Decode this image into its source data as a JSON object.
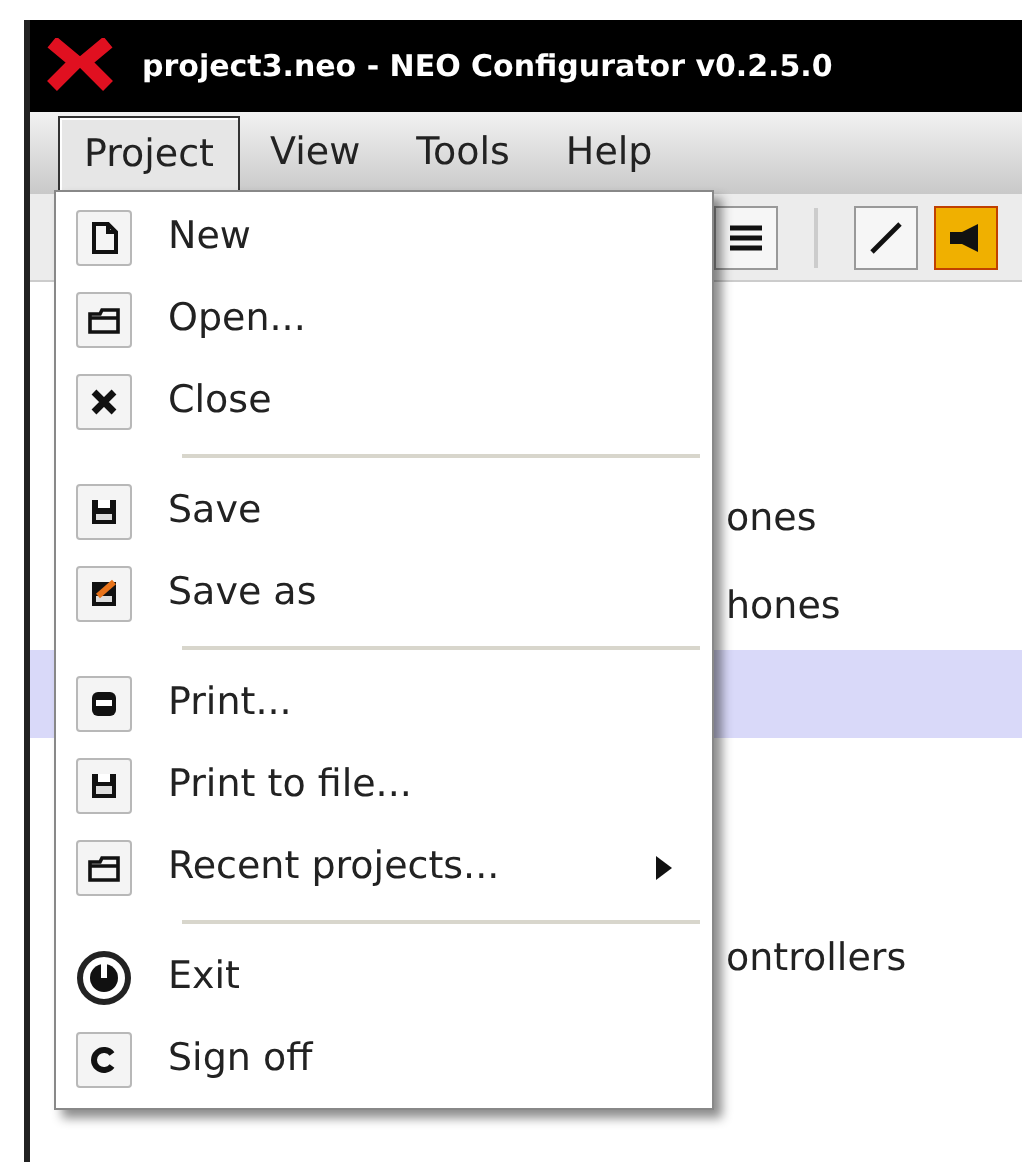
{
  "window": {
    "title": "project3.neo - NEO Configurator v0.2.5.0"
  },
  "menubar": [
    {
      "label": "Project",
      "selected": true
    },
    {
      "label": "View",
      "selected": false
    },
    {
      "label": "Tools",
      "selected": false
    },
    {
      "label": "Help",
      "selected": false
    }
  ],
  "content_rows": [
    {
      "text": "ones",
      "selected": false
    },
    {
      "text": "hones",
      "selected": false
    },
    {
      "selected": true
    },
    {
      "selected": false
    },
    {
      "selected": false
    },
    {
      "text": "ontrollers",
      "selected": false
    }
  ],
  "project_menu": {
    "groups": [
      [
        {
          "label": "New"
        },
        {
          "label": "Open..."
        },
        {
          "label": "Close"
        }
      ],
      [
        {
          "label": "Save"
        },
        {
          "label": "Save as"
        }
      ],
      [
        {
          "label": "Print..."
        },
        {
          "label": "Print to file..."
        },
        {
          "label": "Recent projects...",
          "submenu": true
        }
      ],
      [
        {
          "label": "Exit"
        },
        {
          "label": "Sign off"
        }
      ]
    ]
  }
}
